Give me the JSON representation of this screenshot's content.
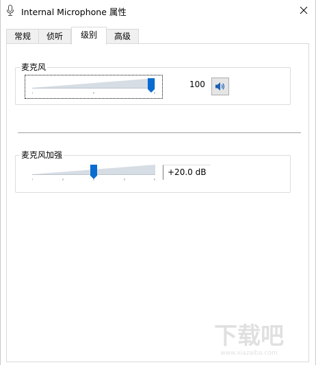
{
  "window": {
    "title": "Internal Microphone 属性",
    "icon": "microphone-icon",
    "close_icon": "close-icon"
  },
  "tabs": [
    {
      "label": "常规",
      "active": false
    },
    {
      "label": "侦听",
      "active": false
    },
    {
      "label": "级别",
      "active": true
    },
    {
      "label": "高级",
      "active": false
    }
  ],
  "microphone": {
    "group_label": "麦克风",
    "level": 100,
    "level_text": "100",
    "mute_icon": "speaker-icon"
  },
  "boost": {
    "group_label": "麦克风加强",
    "value_text": "+20.0 dB",
    "level_fraction": 0.5
  },
  "watermark": {
    "text": "下载吧",
    "subtext": "www.xiazaiba.com"
  }
}
